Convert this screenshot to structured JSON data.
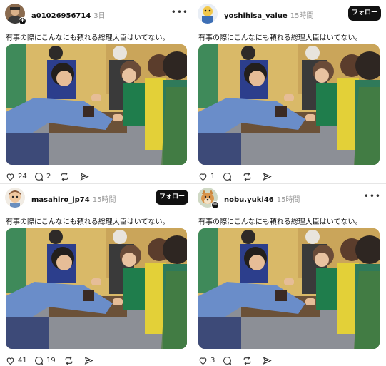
{
  "posts": [
    {
      "username": "a01026956714",
      "time": "3日",
      "caption": "有事の際にこんなにも頼れる総理大臣はいてない。",
      "header_action": "more",
      "likes": "24",
      "replies": "2",
      "avatar_icon": "profile-photo-man",
      "has_plus_badge": true
    },
    {
      "username": "yoshihisa_value",
      "time": "15時間",
      "caption": "有事の際にこんなにも頼れる総理大臣はいてない。",
      "header_action": "follow",
      "follow_label": "フォロー",
      "likes": "1",
      "replies": "",
      "avatar_icon": "cartoon-character-icon",
      "has_plus_badge": false
    },
    {
      "username": "masahiro_jp74",
      "time": "15時間",
      "caption": "有事の際にこんなにも頼れる総理大臣はいてない。",
      "header_action": "follow",
      "follow_label": "フォロー",
      "likes": "",
      "replies": "",
      "avatar_icon": "cartoon-face-icon",
      "has_plus_badge": false
    },
    {
      "username": "nobu.yuki46",
      "time": "15時間",
      "caption": "有事の際にこんなにも頼れる総理大臣はいてない。",
      "header_action": "more",
      "likes": "3",
      "replies": "",
      "avatar_icon": "shiba-dog-icon",
      "has_plus_badge": true
    }
  ],
  "post3_footer": {
    "likes": "41",
    "replies": "19"
  },
  "colors": {
    "text": "#111111",
    "muted": "#999999",
    "follow_bg": "#111111",
    "divider": "#e6e6e6"
  }
}
